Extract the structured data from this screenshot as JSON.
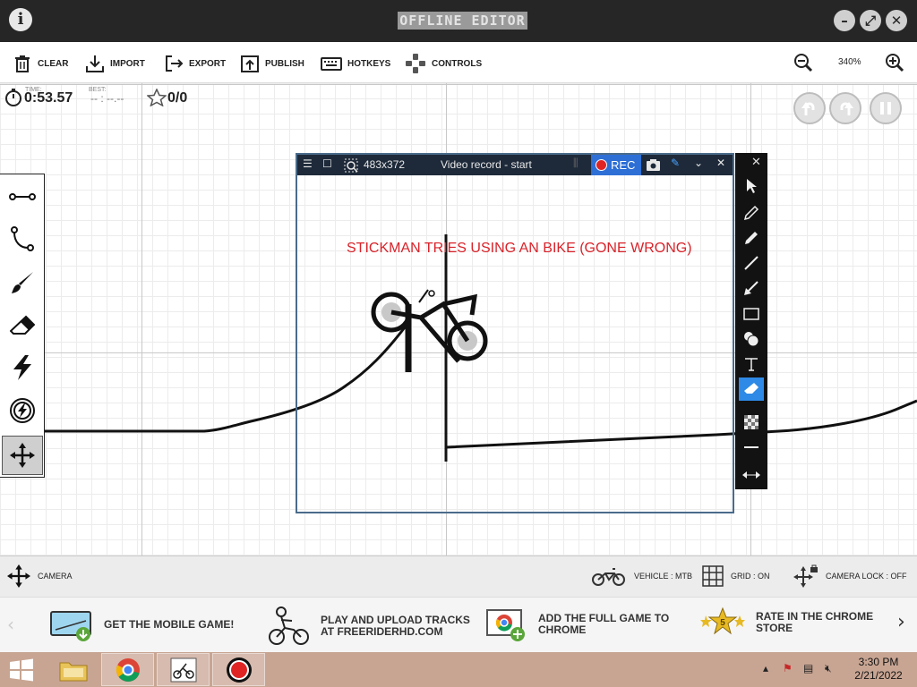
{
  "app": {
    "title": "OFFLINE EDITOR",
    "info_icon": "i",
    "window_buttons": {
      "minimize": "–",
      "maximize": "⤢",
      "close": "✕"
    }
  },
  "toolbar": {
    "items": [
      {
        "label": "CLEAR",
        "icon": "trash-icon"
      },
      {
        "label": "IMPORT",
        "icon": "import-icon"
      },
      {
        "label": "EXPORT",
        "icon": "export-icon"
      },
      {
        "label": "PUBLISH",
        "icon": "publish-icon"
      },
      {
        "label": "HOTKEYS",
        "icon": "keyboard-icon"
      },
      {
        "label": "CONTROLS",
        "icon": "gamepad-icon"
      }
    ],
    "zoom": "340%"
  },
  "hud": {
    "time_label": "TIME:",
    "time_value": "0:53.57",
    "best_label": "BEST:",
    "best_value": "-- : --.--",
    "stars": "0/0"
  },
  "recorder": {
    "size": "483x372",
    "title": "Video record - start",
    "rec_label": "REC",
    "caption": "STICKMAN TRIES USING AN BIKE (GONE WRONG)"
  },
  "statusbar": {
    "camera": "CAMERA",
    "vehicle": "VEHICLE : MTB",
    "grid": "GRID : ON",
    "camera_lock": "CAMERA LOCK : OFF"
  },
  "promo": [
    {
      "text": "GET THE MOBILE GAME!"
    },
    {
      "text": "PLAY AND UPLOAD TRACKS\nAT FREERIDERHD.COM"
    },
    {
      "text": "ADD THE FULL GAME TO\nCHROME"
    },
    {
      "text": "RATE IN THE CHROME\nSTORE"
    }
  ],
  "promo_badge": "5",
  "taskbar": {
    "time": "3:30 PM",
    "date": "2/21/2022"
  },
  "colors": {
    "titlebar": "#262626",
    "rec_accent": "#2e6fd6",
    "caption": "#d8232a",
    "taskbar": "#c8a593"
  }
}
